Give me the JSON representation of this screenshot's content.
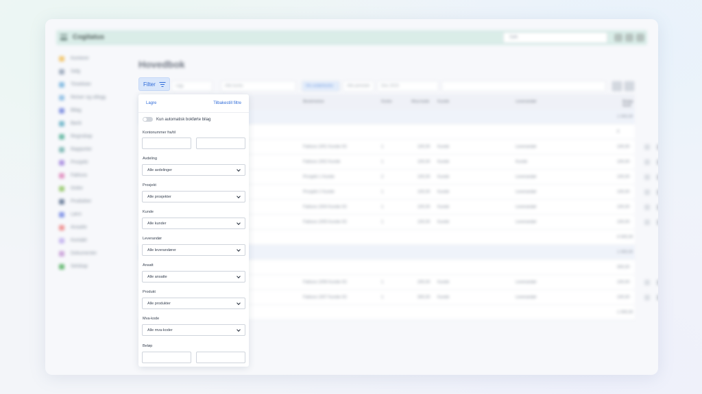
{
  "app": {
    "brand": "Cogitatus",
    "search_placeholder": "Søk",
    "page_title": "Hovedbok"
  },
  "sidebar": {
    "items": [
      {
        "label": "Kontorer",
        "color": "#f2c46a"
      },
      {
        "label": "Salg",
        "color": "#9aa8bb"
      },
      {
        "label": "Timelister",
        "color": "#7fb8e0"
      },
      {
        "label": "Reiser og utlegg",
        "color": "#8fbfe4"
      },
      {
        "label": "Bilag",
        "color": "#7c8ee0"
      },
      {
        "label": "Bank",
        "color": "#6fb5c9"
      },
      {
        "label": "Regnskap",
        "color": "#61b6a0"
      },
      {
        "label": "Rapporter",
        "color": "#7cb7b3"
      },
      {
        "label": "Prosjekt",
        "color": "#a98ee0"
      },
      {
        "label": "Faktura",
        "color": "#e08ebf"
      },
      {
        "label": "Ordre",
        "color": "#98c96f"
      },
      {
        "label": "Produkter",
        "color": "#6a7d99"
      },
      {
        "label": "Lønn",
        "color": "#7d90e6"
      },
      {
        "label": "Ansatte",
        "color": "#ef8e8e"
      },
      {
        "label": "Kontakt",
        "color": "#c3b3ef"
      },
      {
        "label": "Dokumenter",
        "color": "#c9a0d8"
      },
      {
        "label": "Selskap",
        "color": "#62b76f"
      }
    ]
  },
  "toolbar": {
    "year": "Ligg",
    "dimension": "Alle konto",
    "chip_active": "Vis underkonto",
    "chip": "Alle perioder",
    "date": "Des 2023"
  },
  "table": {
    "headers": [
      "Beskrivelse",
      "Konto",
      "Mva-kode",
      "Kunde",
      "Leverandør",
      "Beløp NOK"
    ],
    "rows": [
      {
        "type": "group",
        "amount": "1 000,00"
      },
      {
        "type": "sub",
        "amount": "0"
      },
      {
        "desc": "Faktura 1001 Kunde AS",
        "konto": "1",
        "mva": "100,00",
        "kunde": "Kunde",
        "lev": "Leverandør",
        "amount": "100,00"
      },
      {
        "desc": "Faktura 1002 Kunde",
        "konto": "1",
        "mva": "100,00",
        "kunde": "Kunde",
        "lev": "Kunde",
        "amount": "100,00"
      },
      {
        "desc": "Prosjekt 1 Kunde",
        "konto": "2",
        "mva": "100,00",
        "kunde": "Kunde",
        "lev": "Leverandør",
        "amount": "100,00"
      },
      {
        "desc": "Prosjekt 2 Kunde",
        "konto": "1",
        "mva": "100,00",
        "kunde": "Kunde",
        "lev": "Leverandør",
        "amount": "100,00"
      },
      {
        "desc": "Faktura 1004 Kunde AS",
        "konto": "1",
        "mva": "100,00",
        "kunde": "Kunde",
        "lev": "Leverandør",
        "amount": "100,00"
      },
      {
        "desc": "Faktura 1005 Kunde AS",
        "konto": "1",
        "mva": "100,00",
        "kunde": "Kunde",
        "lev": "Leverandør",
        "amount": "100,00"
      },
      {
        "type": "sum",
        "amount": "4 000,00"
      },
      {
        "type": "group",
        "amount": "1 000,00"
      },
      {
        "type": "sub",
        "amount": "300,00"
      },
      {
        "desc": "Faktura 1006 Kunde AS",
        "konto": "1",
        "mva": "200,00",
        "kunde": "Kunde",
        "lev": "Leverandør",
        "amount": "100,00"
      },
      {
        "desc": "Faktura 1007 Kunde AS",
        "konto": "1",
        "mva": "300,00",
        "kunde": "Kunde",
        "lev": "Leverandør",
        "amount": "100,00"
      },
      {
        "type": "sum",
        "amount": "1 000,00"
      }
    ]
  },
  "filter": {
    "button_label": "Filter",
    "save_label": "Lagre",
    "reset_label": "Tilbakestill filtre",
    "toggle_label": "Kun automatisk bokførte bilag",
    "toggle_on": false,
    "account_label": "Kontonummer fra/til",
    "department_label": "Avdeling",
    "department_value": "Alle avdelinger",
    "project_label": "Prosjekt",
    "project_value": "Alle prosjekter",
    "customer_label": "Kunde",
    "customer_value": "Alle kunder",
    "supplier_label": "Leverandør",
    "supplier_value": "Alle leverandører",
    "employee_label": "Ansatt",
    "employee_value": "Alle ansatte",
    "product_label": "Produkt",
    "product_value": "Alle produkter",
    "vat_label": "Mva-kode",
    "vat_value": "Alle mva-koder",
    "amount_label": "Beløp"
  },
  "colors": {
    "accent": "#2f6bd8",
    "filter_button_bg": "#d8e6fb",
    "topbar": "#d6ebe6"
  }
}
